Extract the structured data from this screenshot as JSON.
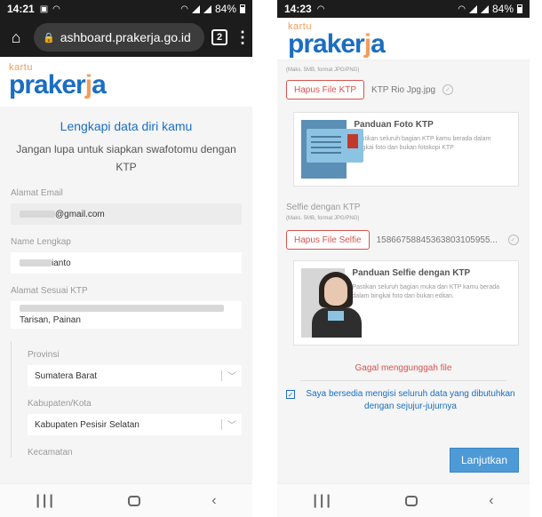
{
  "left": {
    "status": {
      "time": "14:21",
      "battery": "84%"
    },
    "browser": {
      "url": "ashboard.prakerja.go.id",
      "tab_count": "2"
    },
    "logo": {
      "kartu": "kartu",
      "brand_a": "pra",
      "brand_b": "ker",
      "brand_c": "j",
      "brand_d": "a"
    },
    "form": {
      "title": "Lengkapi data diri kamu",
      "subtitle": "Jangan lupa untuk siapkan swafotomu dengan KTP",
      "email_label": "Alamat Email",
      "email_value": "@gmail.com",
      "name_label": "Name Lengkap",
      "name_value": "ianto",
      "address_label": "Alamat Sesuai KTP",
      "address_value": "Tarisan, Painan",
      "province_label": "Provinsi",
      "province_value": "Sumatera Barat",
      "regency_label": "Kabupaten/Kota",
      "regency_value": "Kabupaten Pesisir Selatan",
      "district_label": "Kecamatan"
    }
  },
  "right": {
    "status": {
      "time": "14:23",
      "battery": "84%"
    },
    "logo": {
      "kartu": "kartu",
      "brand_a": "pra",
      "brand_b": "ker",
      "brand_c": "j",
      "brand_d": "a"
    },
    "note_top": "(Maks. 5MB, format JPG/PNG)",
    "ktp": {
      "button": "Hapus File KTP",
      "file_name": "KTP Rio Jpg.jpg",
      "guide_title": "Panduan Foto KTP",
      "guide_text": "Pastikan seluruh bagian KTP kamu berada dalam bingkai foto dan bukan fotokopi KTP"
    },
    "selfie": {
      "label": "Selfie dengan KTP",
      "note": "(Maks. 5MB, format JPG/PNG)",
      "button": "Hapus File Selfie",
      "file_name": "15866758845363803105955...",
      "guide_title": "Panduan Selfie dengan KTP",
      "guide_text": "Pastikan seluruh bagian muka dan KTP kamu berada dalam bingkai foto dan bukan editan."
    },
    "error": "Gagal menggunggah file",
    "agree": "Saya bersedia mengisi seluruh data yang dibutuhkan dengan sejujur-jujurnya",
    "submit": "Lanjutkan"
  }
}
